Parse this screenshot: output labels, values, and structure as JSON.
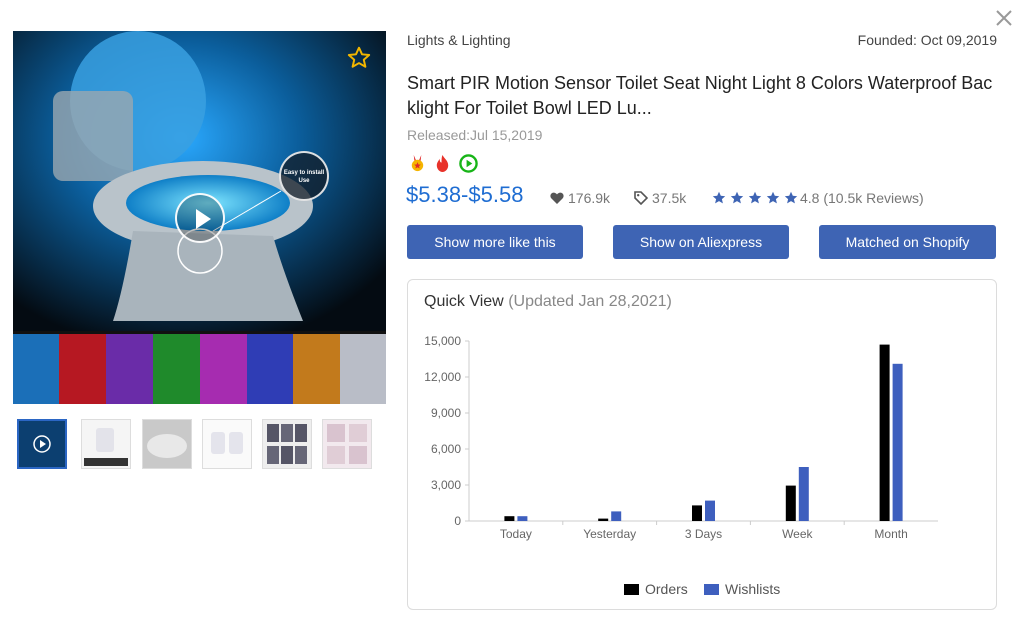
{
  "product": {
    "category": "Lights & Lighting",
    "founded": "Founded: Oct 09,2019",
    "title": "Smart PIR Motion Sensor Toilet Seat Night Light 8 Colors Waterproof Backlight For Toilet Bowl LED Lu...",
    "released": "Released:Jul 15,2019",
    "price": "$5.38-$5.58",
    "likes": "176.9k",
    "orders_tag": "37.5k",
    "rating": "4.8 (10.5k Reviews)",
    "rating_value": 4.8
  },
  "media": {
    "install_badge": "Easy to install Use",
    "thumbnail_count": 6,
    "active_thumbnail": 0
  },
  "buttons": {
    "more_like": "Show more like this",
    "aliexpress": "Show on Aliexpress",
    "shopify": "Matched on Shopify"
  },
  "quick_view": {
    "title": "Quick View",
    "updated": "(Updated Jan 28,2021)"
  },
  "icons": {
    "close": "close-icon",
    "favorite": "star-outline-icon",
    "play": "play-icon",
    "badges": [
      "medal-icon",
      "fire-icon",
      "play-circle-icon"
    ],
    "likes": "heart-icon",
    "orders": "tag-icon",
    "rating": "star-icon"
  },
  "colors": {
    "accent": "#1f6dd2",
    "button": "#3e64b4",
    "star": "#3e64b4",
    "favorite_star": "#f2b600"
  },
  "chart_data": {
    "type": "bar",
    "categories": [
      "Today",
      "Yesterday",
      "3 Days",
      "Week",
      "Month"
    ],
    "series": [
      {
        "name": "Orders",
        "color": "#000000",
        "values": [
          400,
          200,
          1300,
          2950,
          14700
        ]
      },
      {
        "name": "Wishlists",
        "color": "#3e5fbe",
        "values": [
          400,
          800,
          1700,
          4500,
          13100
        ]
      }
    ],
    "yticks": [
      "0",
      "3,000",
      "6,000",
      "9,000",
      "12,000",
      "15,000"
    ],
    "ylim": [
      0,
      15000
    ],
    "grid": false,
    "legend": "bottom"
  }
}
